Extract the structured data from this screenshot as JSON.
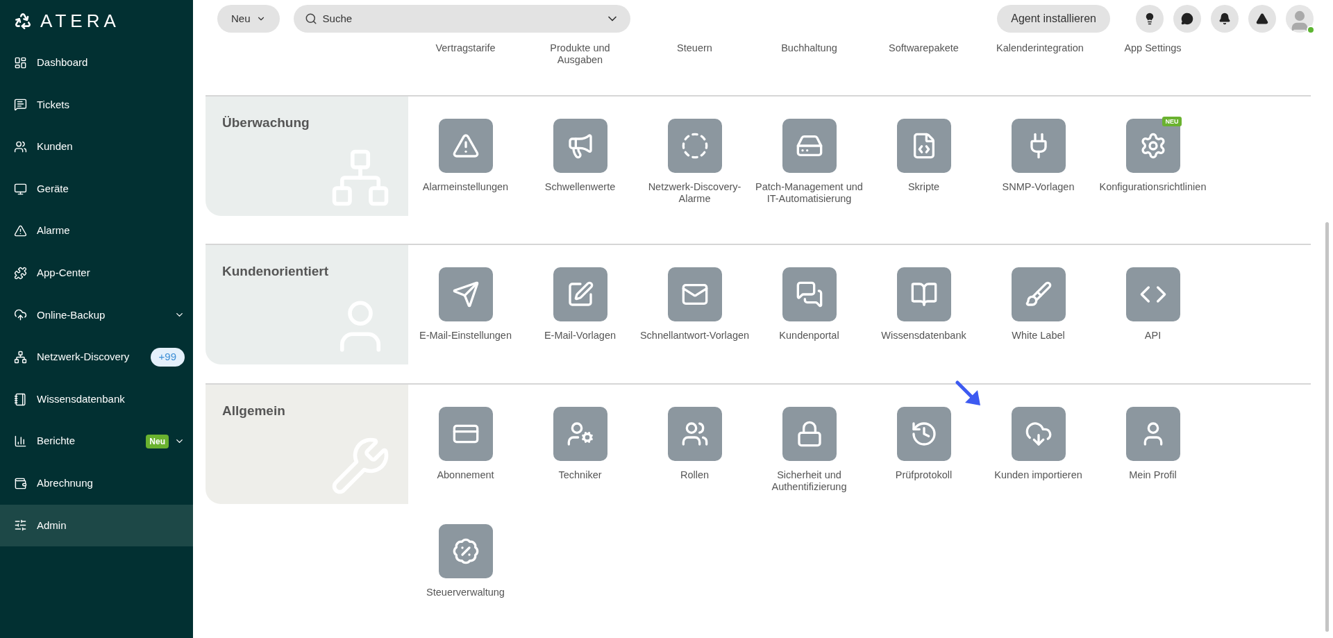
{
  "logo": "ATERA",
  "sidebar": {
    "items": [
      {
        "label": "Dashboard",
        "selected": false,
        "expandable": false
      },
      {
        "label": "Tickets",
        "selected": false,
        "expandable": false
      },
      {
        "label": "Kunden",
        "selected": false,
        "expandable": false
      },
      {
        "label": "Geräte",
        "selected": false,
        "expandable": false
      },
      {
        "label": "Alarme",
        "selected": false,
        "expandable": false
      },
      {
        "label": "App-Center",
        "selected": false,
        "expandable": false
      },
      {
        "label": "Online-Backup",
        "selected": false,
        "expandable": true
      },
      {
        "label": "Netzwerk-Discovery",
        "selected": false,
        "expandable": false,
        "badge": {
          "kind": "count",
          "text": "+99"
        }
      },
      {
        "label": "Wissensdatenbank",
        "selected": false,
        "expandable": false
      },
      {
        "label": "Berichte",
        "selected": false,
        "expandable": true,
        "badge": {
          "kind": "new",
          "text": "Neu"
        }
      },
      {
        "label": "Abrechnung",
        "selected": false,
        "expandable": false
      },
      {
        "label": "Admin",
        "selected": true,
        "expandable": false
      }
    ]
  },
  "header": {
    "new_button": "Neu",
    "search": {
      "placeholder": "Suche"
    },
    "agent_button": "Agent installieren",
    "user": {
      "online": true
    }
  },
  "top_row": [
    "Vertragstarife",
    "Produkte und Ausgaben",
    "Steuern",
    "Buchhaltung",
    "Softwarepakete",
    "Kalenderintegration",
    "App Settings"
  ],
  "sections": [
    {
      "title": "Überwachung",
      "tiles": [
        {
          "label": "Alarmeinstellungen"
        },
        {
          "label": "Schwellenwerte"
        },
        {
          "label": "Netzwerk-Discovery-Alarme"
        },
        {
          "label": "Patch-Management und IT-Automatisierung"
        },
        {
          "label": "Skripte"
        },
        {
          "label": "SNMP-Vorlagen"
        },
        {
          "label": "Konfigurationsrichtlinien",
          "badge": "NEU"
        }
      ]
    },
    {
      "title": "Kundenorientiert",
      "tiles": [
        {
          "label": "E-Mail-Einstellungen"
        },
        {
          "label": "E-Mail-Vorlagen"
        },
        {
          "label": "Schnellantwort-Vorlagen"
        },
        {
          "label": "Kundenportal"
        },
        {
          "label": "Wissensdatenbank"
        },
        {
          "label": "White Label"
        },
        {
          "label": "API"
        }
      ]
    },
    {
      "title": "Allgemein",
      "tiles": [
        {
          "label": "Abonnement"
        },
        {
          "label": "Techniker"
        },
        {
          "label": "Rollen"
        },
        {
          "label": "Sicherheit und Authentifizierung"
        },
        {
          "label": "Prüfprotokoll"
        },
        {
          "label": "Kunden importieren"
        },
        {
          "label": "Mein Profil"
        },
        {
          "label": "Steuerverwaltung"
        }
      ]
    }
  ]
}
